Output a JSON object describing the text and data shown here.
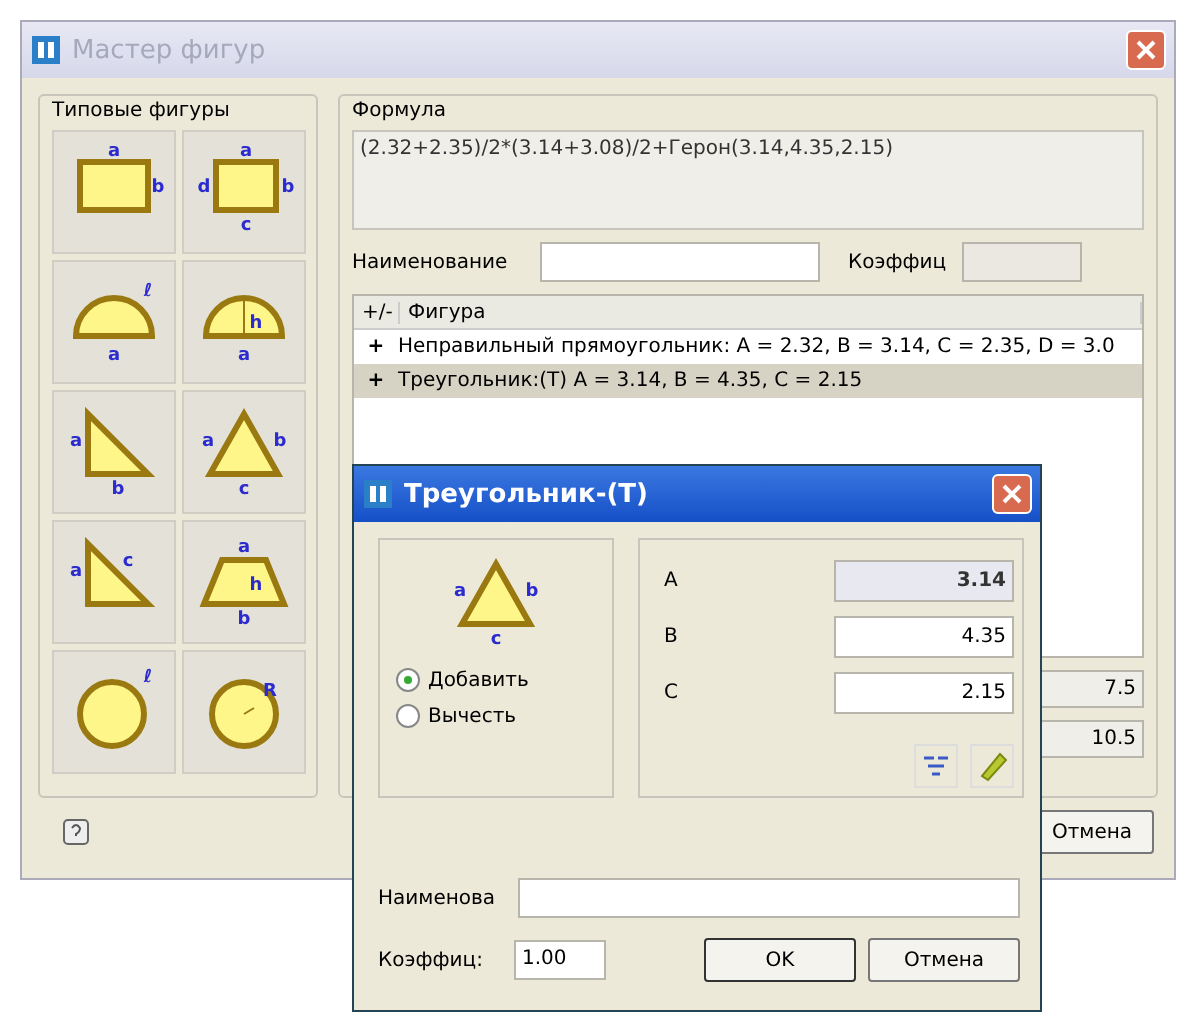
{
  "window": {
    "title": "Мастер фигур",
    "active": false
  },
  "shapes_group": {
    "title": "Типовые фигуры",
    "shapes": [
      {
        "kind": "rect",
        "labels": [
          "a",
          "b"
        ]
      },
      {
        "kind": "rect4",
        "labels": [
          "a",
          "b",
          "c",
          "d"
        ]
      },
      {
        "kind": "semicircle",
        "labels": [
          "ℓ",
          "a"
        ]
      },
      {
        "kind": "semicircle_h",
        "labels": [
          "h",
          "a"
        ]
      },
      {
        "kind": "right_triangle",
        "labels": [
          "a",
          "b"
        ]
      },
      {
        "kind": "triangle",
        "labels": [
          "a",
          "b",
          "c"
        ]
      },
      {
        "kind": "right_triangle_c",
        "labels": [
          "a",
          "c"
        ]
      },
      {
        "kind": "trapezoid",
        "labels": [
          "a",
          "h",
          "b"
        ]
      },
      {
        "kind": "circle",
        "labels": [
          "ℓ"
        ]
      },
      {
        "kind": "circle_r",
        "labels": [
          "R"
        ]
      }
    ]
  },
  "formula_group": {
    "title": "Формула",
    "formula": "(2.32+2.35)/2*(3.14+3.08)/2+Герон(3.14,4.35,2.15)",
    "name_label": "Наименование",
    "coef_label": "Коэффиц",
    "list": {
      "columns": [
        "+/-",
        "Фигура"
      ],
      "rows": [
        {
          "sign": "+",
          "text": "Неправильный прямоугольник: A = 2.32, B = 3.14, C = 2.35, D = 3.0",
          "selected": false
        },
        {
          "sign": "+",
          "text": "Треугольник:(T) A = 3.14, B = 4.35, C = 2.15",
          "selected": true
        }
      ]
    },
    "results": [
      "7.5",
      "10.5"
    ]
  },
  "cancel_button": "Отмена",
  "dialog": {
    "title": "Треугольник-(T)",
    "shape": {
      "kind": "triangle",
      "labels": [
        "a",
        "b",
        "c"
      ]
    },
    "radios": [
      {
        "label": "Добавить",
        "selected": true
      },
      {
        "label": "Вычесть",
        "selected": false
      }
    ],
    "params": [
      {
        "label": "A",
        "value": "3.14",
        "selected": true
      },
      {
        "label": "B",
        "value": "4.35",
        "selected": false
      },
      {
        "label": "C",
        "value": "2.15",
        "selected": false
      }
    ],
    "name_label": "Наименова",
    "coef_label": "Коэффиц:",
    "coef_value": "1.00",
    "ok_button": "OK",
    "cancel_button": "Отмена"
  }
}
